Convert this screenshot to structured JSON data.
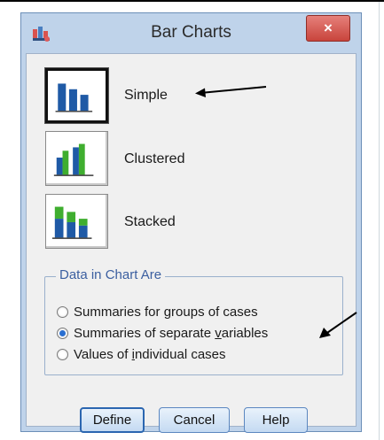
{
  "window": {
    "title": "Bar Charts",
    "close_label": "×"
  },
  "chart_types": [
    {
      "label": "Simple",
      "selected": true
    },
    {
      "label": "Clustered",
      "selected": false
    },
    {
      "label": "Stacked",
      "selected": false
    }
  ],
  "data_group": {
    "legend": "Data in Chart Are",
    "options": [
      {
        "pre": "Summaries for ",
        "key": "g",
        "post": "roups of cases",
        "checked": false
      },
      {
        "pre": "Summaries of separate ",
        "key": "v",
        "post": "ariables",
        "checked": true
      },
      {
        "pre": "Values of ",
        "key": "i",
        "post": "ndividual cases",
        "checked": false
      }
    ]
  },
  "buttons": {
    "define": "Define",
    "cancel": "Cancel",
    "help": "Help"
  },
  "colors": {
    "bar_blue": "#1f5aa6",
    "bar_green": "#3fae2f",
    "title_bg": "#bfd3ea",
    "close_red": "#c8443c"
  }
}
